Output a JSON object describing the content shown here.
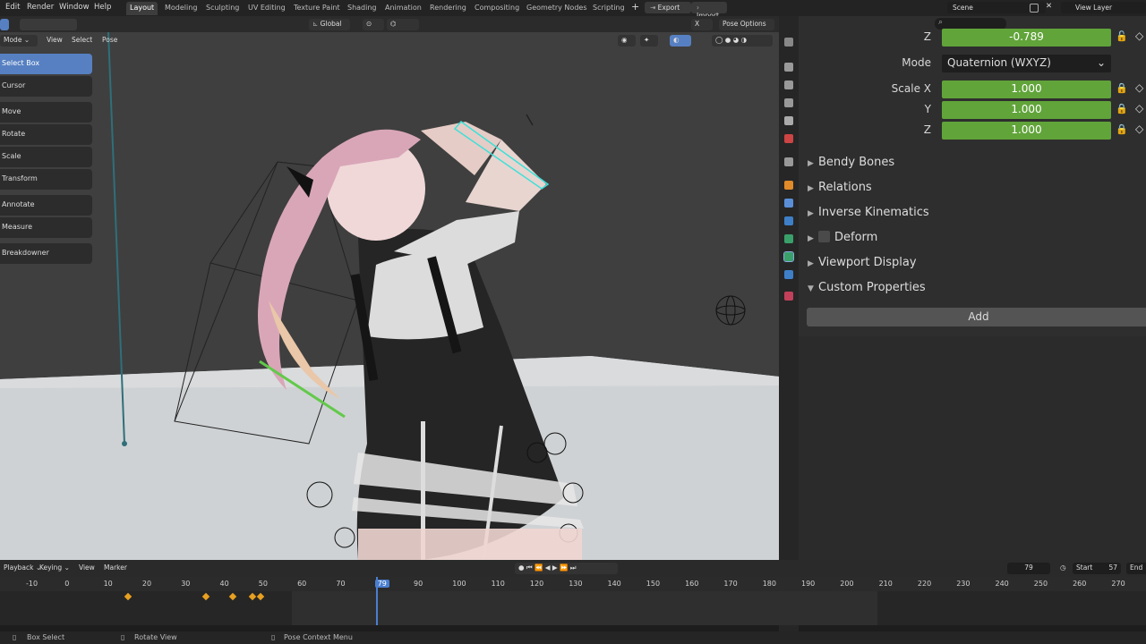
{
  "topbar": {
    "menus": [
      "Edit",
      "Render",
      "Window",
      "Help"
    ],
    "workspaces": [
      "Layout",
      "Modeling",
      "Sculpting",
      "UV Editing",
      "Texture Paint",
      "Shading",
      "Animation",
      "Rendering",
      "Compositing",
      "Geometry Nodes",
      "Scripting"
    ],
    "active_workspace": "Layout",
    "addons": [
      "Export",
      "Import"
    ],
    "scene": "Scene",
    "view_layer": "View Layer"
  },
  "viewport_header": {
    "mode": "Mode",
    "menus": [
      "View",
      "Select",
      "Pose"
    ],
    "orientation": "Global",
    "pose_options": "Pose Options",
    "x_label": "X"
  },
  "tools": [
    {
      "label": "Select Box",
      "active": true
    },
    {
      "label": "Cursor"
    },
    {
      "label": "Move"
    },
    {
      "label": "Rotate"
    },
    {
      "label": "Scale"
    },
    {
      "label": "Transform"
    },
    {
      "label": "Annotate"
    },
    {
      "label": "Measure"
    },
    {
      "label": "Breakdowner"
    }
  ],
  "properties": {
    "rotation_z_label": "Z",
    "rotation_z_value": "-0.789",
    "mode_label": "Mode",
    "mode_value": "Quaternion (WXYZ)",
    "scale_x_label": "Scale X",
    "scale_x": "1.000",
    "scale_y_label": "Y",
    "scale_y": "1.000",
    "scale_z_label": "Z",
    "scale_z": "1.000",
    "panels": [
      "Bendy Bones",
      "Relations",
      "Inverse Kinematics",
      "Deform",
      "Viewport Display",
      "Custom Properties"
    ],
    "add_button": "Add"
  },
  "timeline": {
    "menus": [
      "Playback",
      "Keying",
      "View",
      "Marker"
    ],
    "current_frame": "79",
    "start_label": "Start",
    "start_value": "57",
    "end_label": "End",
    "ruler": [
      "-10",
      "0",
      "10",
      "20",
      "30",
      "40",
      "50",
      "60",
      "70",
      "79",
      "90",
      "100",
      "110",
      "120",
      "130",
      "140",
      "150",
      "160",
      "170",
      "180",
      "190",
      "200",
      "210",
      "220",
      "230",
      "240",
      "250",
      "260",
      "270"
    ]
  },
  "statusbar": {
    "hint1": "Box Select",
    "hint2": "Rotate View",
    "hint3": "Pose Context Menu"
  },
  "colors": {
    "accent_blue": "#5680c2",
    "field_green": "#61a43a",
    "playhead": "#4a7fd0"
  }
}
